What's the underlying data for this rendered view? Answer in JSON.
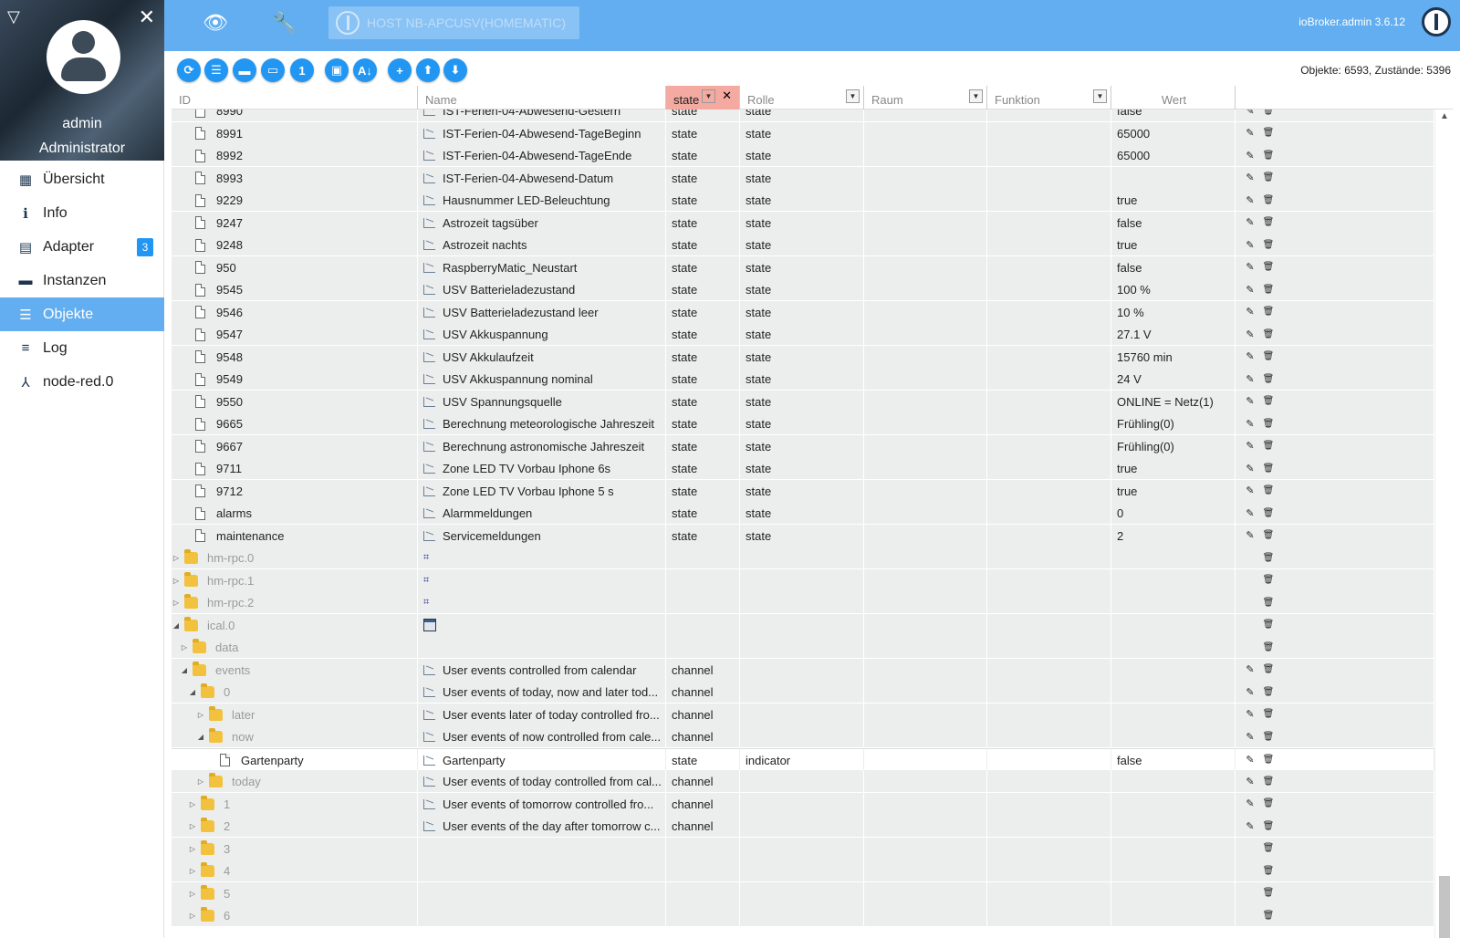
{
  "sidebar": {
    "user": {
      "name": "admin",
      "role": "Administrator"
    },
    "items": [
      {
        "label": "Übersicht",
        "icon": "grid-icon"
      },
      {
        "label": "Info",
        "icon": "info-icon"
      },
      {
        "label": "Adapter",
        "icon": "store-icon",
        "badge": "3"
      },
      {
        "label": "Instanzen",
        "icon": "instances-icon"
      },
      {
        "label": "Objekte",
        "icon": "list-icon",
        "active": true
      },
      {
        "label": "Log",
        "icon": "log-icon"
      },
      {
        "label": "node-red.0",
        "icon": "node-icon"
      }
    ]
  },
  "topbar": {
    "host": "HOST NB-APCUSV(HOMEMATIC)",
    "version": "ioBroker.admin 3.6.12"
  },
  "toolbar": {
    "counts": "Objekte: 6593, Zustände: 5396"
  },
  "columns": {
    "id": "ID",
    "name": "Name",
    "type_filter": "state",
    "role": "Rolle",
    "room": "Raum",
    "function": "Funktion",
    "value": "Wert"
  },
  "rows": [
    {
      "id": "8990",
      "name": "IST-Ferien-04-Abwesend-Gestern",
      "type": "state",
      "role": "state",
      "value": "false",
      "kind": "file",
      "indent": 0,
      "actions": "edit-delete"
    },
    {
      "id": "8991",
      "name": "IST-Ferien-04-Abwesend-TageBeginn",
      "type": "state",
      "role": "state",
      "value": "65000",
      "kind": "file",
      "indent": 0,
      "actions": "edit-delete"
    },
    {
      "id": "8992",
      "name": "IST-Ferien-04-Abwesend-TageEnde",
      "type": "state",
      "role": "state",
      "value": "65000",
      "kind": "file",
      "indent": 0,
      "actions": "edit-delete"
    },
    {
      "id": "8993",
      "name": "IST-Ferien-04-Abwesend-Datum",
      "type": "state",
      "role": "state",
      "value": "",
      "kind": "file",
      "indent": 0,
      "actions": "edit-delete"
    },
    {
      "id": "9229",
      "name": "Hausnummer LED-Beleuchtung",
      "type": "state",
      "role": "state",
      "value": "true",
      "kind": "file",
      "indent": 0,
      "actions": "edit-delete"
    },
    {
      "id": "9247",
      "name": "Astrozeit tagsüber",
      "type": "state",
      "role": "state",
      "value": "false",
      "kind": "file",
      "indent": 0,
      "actions": "edit-delete"
    },
    {
      "id": "9248",
      "name": "Astrozeit nachts",
      "type": "state",
      "role": "state",
      "value": "true",
      "kind": "file",
      "indent": 0,
      "actions": "edit-delete"
    },
    {
      "id": "950",
      "name": "RaspberryMatic_Neustart",
      "type": "state",
      "role": "state",
      "value": "false",
      "kind": "file",
      "indent": 0,
      "actions": "edit-delete"
    },
    {
      "id": "9545",
      "name": "USV Batterieladezustand",
      "type": "state",
      "role": "state",
      "value": "100 %",
      "kind": "file",
      "indent": 0,
      "actions": "edit-delete"
    },
    {
      "id": "9546",
      "name": "USV Batterieladezustand leer",
      "type": "state",
      "role": "state",
      "value": "10 %",
      "kind": "file",
      "indent": 0,
      "actions": "edit-delete"
    },
    {
      "id": "9547",
      "name": "USV Akkuspannung",
      "type": "state",
      "role": "state",
      "value": "27.1 V",
      "kind": "file",
      "indent": 0,
      "actions": "edit-delete"
    },
    {
      "id": "9548",
      "name": "USV Akkulaufzeit",
      "type": "state",
      "role": "state",
      "value": "15760 min",
      "kind": "file",
      "indent": 0,
      "actions": "edit-delete"
    },
    {
      "id": "9549",
      "name": "USV Akkuspannung nominal",
      "type": "state",
      "role": "state",
      "value": "24 V",
      "kind": "file",
      "indent": 0,
      "actions": "edit-delete"
    },
    {
      "id": "9550",
      "name": "USV Spannungsquelle",
      "type": "state",
      "role": "state",
      "value": "ONLINE = Netz(1)",
      "kind": "file",
      "indent": 0,
      "actions": "edit-delete"
    },
    {
      "id": "9665",
      "name": "Berechnung meteorologische Jahreszeit",
      "type": "state",
      "role": "state",
      "value": "Frühling(0)",
      "kind": "file",
      "indent": 0,
      "actions": "edit-delete"
    },
    {
      "id": "9667",
      "name": "Berechnung astronomische Jahreszeit",
      "type": "state",
      "role": "state",
      "value": "Frühling(0)",
      "kind": "file",
      "indent": 0,
      "actions": "edit-delete"
    },
    {
      "id": "9711",
      "name": "Zone LED TV Vorbau Iphone 6s",
      "type": "state",
      "role": "state",
      "value": "true",
      "kind": "file",
      "indent": 0,
      "actions": "edit-delete"
    },
    {
      "id": "9712",
      "name": "Zone LED TV Vorbau Iphone 5 s",
      "type": "state",
      "role": "state",
      "value": "true",
      "kind": "file",
      "indent": 0,
      "actions": "edit-delete"
    },
    {
      "id": "alarms",
      "name": "Alarmmeldungen",
      "type": "state",
      "role": "state",
      "value": "0",
      "kind": "file",
      "indent": 0,
      "actions": "edit-delete"
    },
    {
      "id": "maintenance",
      "name": "Servicemeldungen",
      "type": "state",
      "role": "state",
      "value": "2",
      "kind": "file",
      "indent": 0,
      "actions": "edit-delete"
    },
    {
      "id": "hm-rpc.0",
      "name": "",
      "type": "",
      "role": "",
      "value": "",
      "kind": "folder",
      "toggle": "closed",
      "indent": -1,
      "icon": "adapter-icon",
      "actions": "delete"
    },
    {
      "id": "hm-rpc.1",
      "name": "",
      "type": "",
      "role": "",
      "value": "",
      "kind": "folder",
      "toggle": "closed",
      "indent": -1,
      "icon": "adapter-icon",
      "actions": "delete"
    },
    {
      "id": "hm-rpc.2",
      "name": "",
      "type": "",
      "role": "",
      "value": "",
      "kind": "folder",
      "toggle": "closed",
      "indent": -1,
      "icon": "adapter-icon",
      "actions": "delete"
    },
    {
      "id": "ical.0",
      "name": "",
      "type": "",
      "role": "",
      "value": "",
      "kind": "folder",
      "toggle": "open",
      "indent": -1,
      "icon": "calendar-icon",
      "actions": "delete"
    },
    {
      "id": "data",
      "name": "",
      "type": "",
      "role": "",
      "value": "",
      "kind": "folder",
      "toggle": "closed",
      "indent": 0,
      "actions": "delete"
    },
    {
      "id": "events",
      "name": "User events controlled from calendar",
      "type": "channel",
      "role": "",
      "value": "",
      "kind": "folder",
      "toggle": "open",
      "indent": 0,
      "icon": "state-icon",
      "actions": "edit-delete"
    },
    {
      "id": "0",
      "name": "User events of today, now and later tod...",
      "type": "channel",
      "role": "",
      "value": "",
      "kind": "folder",
      "toggle": "open",
      "indent": 1,
      "icon": "state-icon",
      "actions": "edit-delete"
    },
    {
      "id": "later",
      "name": "User events later of today controlled fro...",
      "type": "channel",
      "role": "",
      "value": "",
      "kind": "folder",
      "toggle": "closed",
      "indent": 2,
      "icon": "state-icon",
      "actions": "edit-delete"
    },
    {
      "id": "now",
      "name": "User events of now controlled from cale...",
      "type": "channel",
      "role": "",
      "value": "",
      "kind": "folder",
      "toggle": "open",
      "indent": 2,
      "icon": "state-icon",
      "actions": "edit-delete"
    },
    {
      "id": "Gartenparty",
      "name": "Gartenparty",
      "type": "state",
      "role": "indicator",
      "value": "false",
      "kind": "file",
      "indent": 3,
      "icon": "state-icon",
      "actions": "edit-delete",
      "highlight": true
    },
    {
      "id": "today",
      "name": "User events of today controlled from cal...",
      "type": "channel",
      "role": "",
      "value": "",
      "kind": "folder",
      "toggle": "closed",
      "indent": 2,
      "icon": "state-icon",
      "actions": "edit-delete"
    },
    {
      "id": "1",
      "name": "User events of tomorrow controlled fro...",
      "type": "channel",
      "role": "",
      "value": "",
      "kind": "folder",
      "toggle": "closed",
      "indent": 1,
      "icon": "state-icon",
      "actions": "edit-delete"
    },
    {
      "id": "2",
      "name": "User events of the day after tomorrow c...",
      "type": "channel",
      "role": "",
      "value": "",
      "kind": "folder",
      "toggle": "closed",
      "indent": 1,
      "icon": "state-icon",
      "actions": "edit-delete"
    },
    {
      "id": "3",
      "name": "",
      "type": "",
      "role": "",
      "value": "",
      "kind": "folder",
      "toggle": "closed",
      "indent": 1,
      "actions": "delete"
    },
    {
      "id": "4",
      "name": "",
      "type": "",
      "role": "",
      "value": "",
      "kind": "folder",
      "toggle": "closed",
      "indent": 1,
      "actions": "delete"
    },
    {
      "id": "5",
      "name": "",
      "type": "",
      "role": "",
      "value": "",
      "kind": "folder",
      "toggle": "closed",
      "indent": 1,
      "actions": "delete"
    },
    {
      "id": "6",
      "name": "",
      "type": "",
      "role": "",
      "value": "",
      "kind": "folder",
      "toggle": "closed",
      "indent": 1,
      "actions": "delete"
    }
  ]
}
